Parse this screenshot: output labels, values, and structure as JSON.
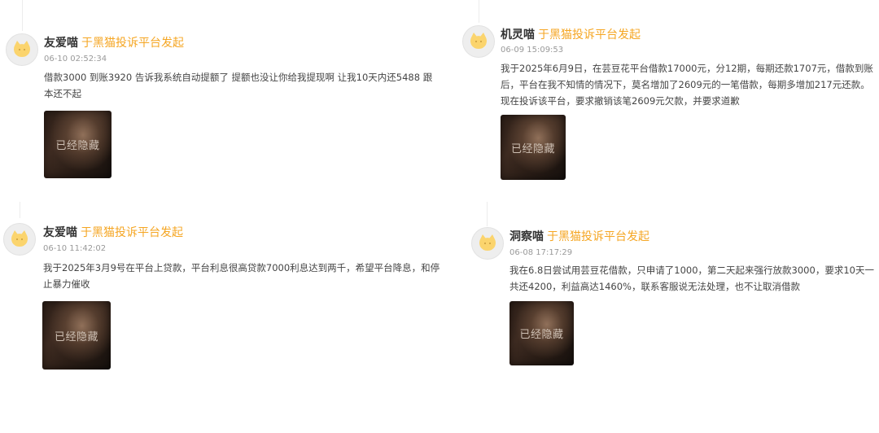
{
  "accent_color": "#f5a623",
  "complaints": [
    {
      "username": "友爱喵",
      "source": "于黑猫投诉平台发起",
      "time": "06-10 02:52:34",
      "content": "借款3000 到账3920 告诉我系统自动提额了 提额也没让你给我提现啊 让我10天内还5488 跟本还不起",
      "thumb_label": "已经隐藏",
      "avatar_icon": "cat-avatar-icon"
    },
    {
      "username": "机灵喵",
      "source": "于黑猫投诉平台发起",
      "time": "06-09 15:09:53",
      "content": "我于2025年6月9日，在芸豆花平台借款17000元，分12期，每期还款1707元，借款到账后，平台在我不知情的情况下，莫名增加了2609元的一笔借款，每期多增加217元还款。现在投诉该平台，要求撤销该笔2609元欠款，并要求道歉",
      "thumb_label": "已经隐藏",
      "avatar_icon": "cat-avatar-icon"
    },
    {
      "username": "友爱喵",
      "source": "于黑猫投诉平台发起",
      "time": "06-10 11:42:02",
      "content": "我于2025年3月9号在平台上贷款，平台利息很高贷款7000利息达到两千，希望平台降息，和停止暴力催收",
      "thumb_label": "已经隐藏",
      "avatar_icon": "cat-avatar-icon"
    },
    {
      "username": "洞察喵",
      "source": "于黑猫投诉平台发起",
      "time": "06-08 17:17:29",
      "content": "我在6.8日尝试用芸豆花借款，只申请了1000，第二天起来强行放款3000，要求10天一共还4200，利益高达1460%，联系客服说无法处理，也不让取消借款",
      "thumb_label": "已经隐藏",
      "avatar_icon": "cat-avatar-icon"
    }
  ]
}
